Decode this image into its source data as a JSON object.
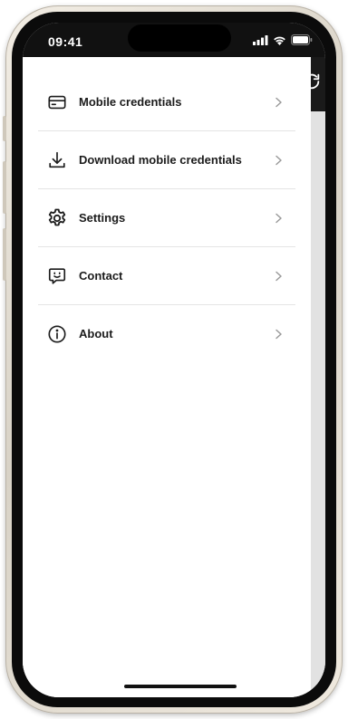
{
  "status_bar": {
    "time": "09:41",
    "icons": [
      "signal-icon",
      "wifi-icon",
      "battery-icon"
    ]
  },
  "background_app": {
    "header_icon": "refresh-icon"
  },
  "menu": {
    "items": [
      {
        "label": "Mobile credentials",
        "icon": "credential-card-icon"
      },
      {
        "label": "Download mobile credentials",
        "icon": "download-icon"
      },
      {
        "label": "Settings",
        "icon": "gear-icon"
      },
      {
        "label": "Contact",
        "icon": "chat-smile-icon"
      },
      {
        "label": "About",
        "icon": "info-icon"
      }
    ]
  },
  "colors": {
    "text": "#1b1b1b",
    "divider": "#e4e4e4",
    "chevron": "#9a9a9a",
    "status_bar_bg": "#111111"
  }
}
